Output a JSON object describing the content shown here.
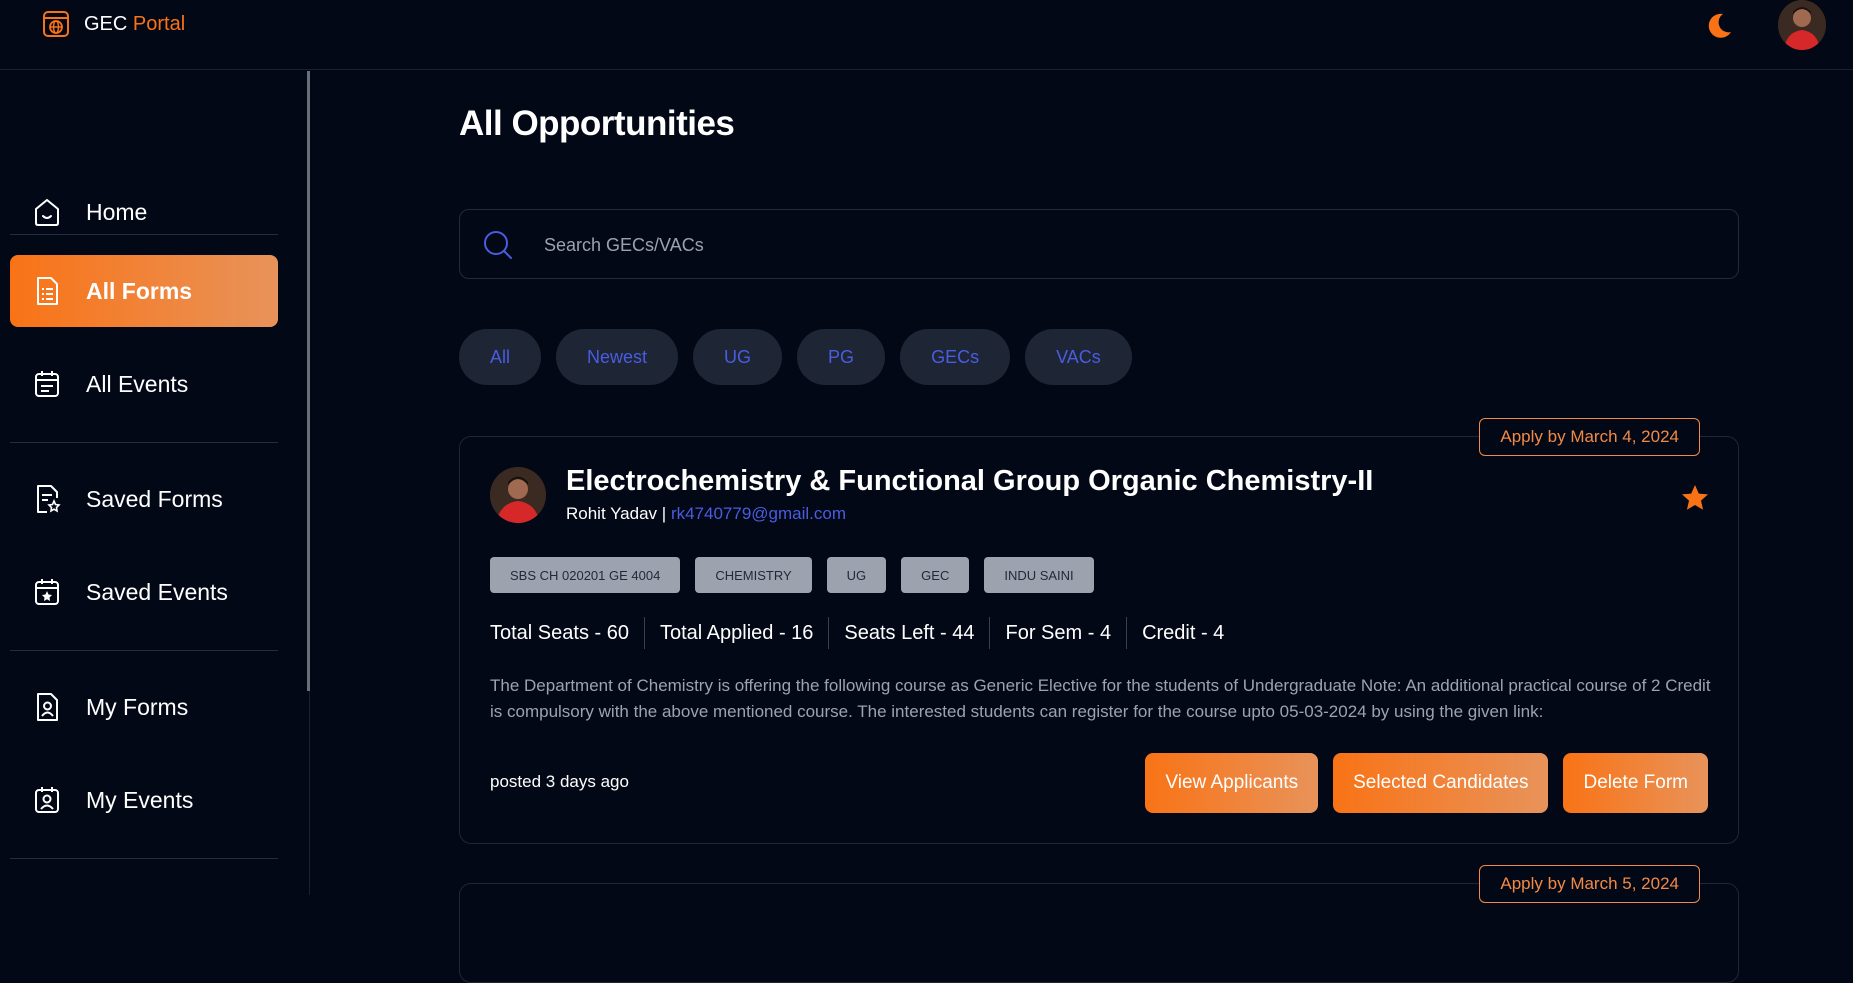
{
  "brand": {
    "name": "GEC",
    "accent": "Portal"
  },
  "header": {
    "theme_icon": "moon-icon",
    "avatar": "user-avatar"
  },
  "sidebar": {
    "items": [
      {
        "label": "Home",
        "icon": "home-icon"
      },
      {
        "label": "All Forms",
        "icon": "document-icon",
        "active": true
      },
      {
        "label": "All Events",
        "icon": "calendar-icon"
      },
      {
        "label": "Saved Forms",
        "icon": "saved-form-icon"
      },
      {
        "label": "Saved Events",
        "icon": "saved-calendar-icon"
      },
      {
        "label": "My Forms",
        "icon": "user-document-icon"
      },
      {
        "label": "My Events",
        "icon": "user-calendar-icon"
      }
    ]
  },
  "main": {
    "title": "All Opportunities",
    "search": {
      "placeholder": "Search GECs/VACs"
    },
    "filters": [
      "All",
      "Newest",
      "UG",
      "PG",
      "GECs",
      "VACs"
    ],
    "cards": [
      {
        "deadline": "Apply by March 4, 2024",
        "title": "Electrochemistry & Functional Group Organic Chemistry-II",
        "author": "Rohit Yadav",
        "separator": "|",
        "email": "rk4740779@gmail.com",
        "tags": [
          "SBS CH 020201 GE 4004",
          "CHEMISTRY",
          "UG",
          "GEC",
          "INDU SAINI"
        ],
        "stats": [
          "Total Seats - 60",
          "Total Applied - 16",
          "Seats Left - 44",
          "For Sem - 4",
          "Credit - 4"
        ],
        "description": "The Department of Chemistry is offering the following course as Generic Elective for the students of Undergraduate Note: An additional practical course of 2 Credit is compulsory with the above mentioned course. The interested students can register for the course upto 05-03-2024 by using the given link:",
        "posted": "posted 3 days ago",
        "actions": [
          "View Applicants",
          "Selected Candidates",
          "Delete Form"
        ]
      },
      {
        "deadline": "Apply by March 5, 2024"
      }
    ]
  },
  "colors": {
    "accent": "#f97316",
    "background": "#030816",
    "link": "#4a5ce0",
    "tag_bg": "#9ca3af"
  }
}
